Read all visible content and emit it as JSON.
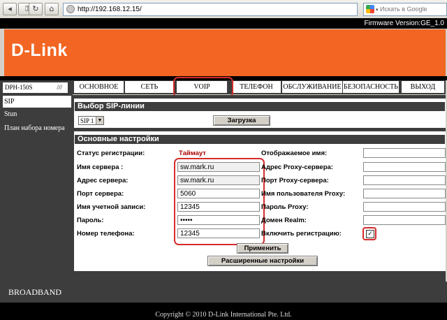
{
  "browser": {
    "url": "http://192.168.12.15/",
    "search_placeholder": "Искать в Google",
    "nav_icons": [
      "back-icon",
      "key-icon",
      "refresh-icon",
      "home-icon",
      "page-icon"
    ]
  },
  "header": {
    "firmware": "Firmware Version:GE_1.0",
    "logo": "D-Link",
    "model": "DPH-150S",
    "accent_color": "#f26522"
  },
  "sidebar": {
    "items": [
      {
        "label": "SIP"
      },
      {
        "label": "Stun"
      },
      {
        "label": "План набора номера"
      }
    ]
  },
  "tabs": [
    {
      "label": "ОСНОВНОЕ"
    },
    {
      "label": "СЕТЬ"
    },
    {
      "label": "VOIP"
    },
    {
      "label": "ТЕЛЕФОН"
    },
    {
      "label": "ОБСЛУЖИВАНИЕ"
    },
    {
      "label": "БЕЗОПАСНОСТЬ"
    },
    {
      "label": "ВЫХОД"
    }
  ],
  "sip_select": {
    "title": "Выбор SIP-линии",
    "selected": "SIP 1",
    "load_button": "Загрузка"
  },
  "settings": {
    "title": "Основные настройки",
    "left": [
      {
        "label": "Статус регистрации:",
        "value": "Таймаут"
      },
      {
        "label": "Имя сервера :",
        "value": "sw.mark.ru"
      },
      {
        "label": "Адрес сервера:",
        "value": "sw.mark.ru"
      },
      {
        "label": "Порт сервера:",
        "value": "5060"
      },
      {
        "label": "Имя учетной записи:",
        "value": "12345"
      },
      {
        "label": "Пароль:",
        "value": "•••••"
      },
      {
        "label": "Номер телефона:",
        "value": "12345"
      }
    ],
    "right": [
      {
        "label": "Отображаемое имя:"
      },
      {
        "label": "Адрес Proxy-сервера:"
      },
      {
        "label": "Порт Proxy-сервера:"
      },
      {
        "label": "Имя пользователя Proxy:"
      },
      {
        "label": "Пароль Proxy:"
      },
      {
        "label": "Домен Realm:"
      },
      {
        "label": "Включить регистрацию:"
      }
    ],
    "enable_checked": "✓",
    "status_color": "#b00000",
    "apply_button": "Применить",
    "advanced_button": "Расширенные настройки"
  },
  "footer": {
    "broadband": "BROADBAND",
    "copyright": "Copyright © 2010 D-Link International Pte. Ltd."
  }
}
